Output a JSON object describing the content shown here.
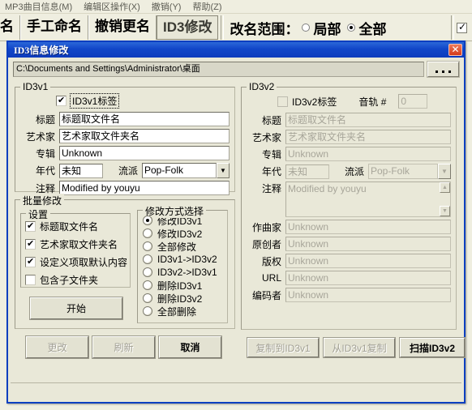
{
  "background": {
    "menubar": [
      {
        "label": "MP3曲目信息(M)"
      },
      {
        "label": "编辑区操作(X)"
      },
      {
        "label": "撤销(Y)"
      },
      {
        "label": "帮助(Z)"
      }
    ],
    "toolbar": {
      "partial_button": "名",
      "buttons": [
        {
          "label": "手工命名",
          "state": "normal"
        },
        {
          "label": "撤销更名",
          "state": "normal"
        },
        {
          "label": "ID3修改",
          "state": "pressed"
        }
      ],
      "scope_label": "改名范围：",
      "scope_options": [
        {
          "label": "局部",
          "selected": false
        },
        {
          "label": "全部",
          "selected": true
        }
      ],
      "right_checkbox_checked": true
    }
  },
  "dialog": {
    "title": "ID3信息修改",
    "close_label": "✕",
    "path": {
      "value": "C:\\Documents and Settings\\Administrator\\桌面",
      "browse_label": "..."
    },
    "id3v1": {
      "legend": "ID3v1",
      "tag_checkbox": {
        "label": "ID3v1标签",
        "checked": true
      },
      "fields": [
        {
          "label": "标题",
          "value": "标题取文件名"
        },
        {
          "label": "艺术家",
          "value": "艺术家取文件夹名"
        },
        {
          "label": "专辑",
          "value": "Unknown"
        }
      ],
      "year": {
        "label": "年代",
        "value": "未知"
      },
      "genre": {
        "label": "流派",
        "value": "Pop-Folk"
      },
      "comment": {
        "label": "注释",
        "value": "Modified by youyu"
      }
    },
    "id3v2": {
      "legend": "ID3v2",
      "tag_checkbox": {
        "label": "ID3v2标签",
        "checked": false
      },
      "track": {
        "label": "音轨 #",
        "value": "0"
      },
      "fields": [
        {
          "label": "标题",
          "value": "标题取文件名"
        },
        {
          "label": "艺术家",
          "value": "艺术家取文件夹名"
        },
        {
          "label": "专辑",
          "value": "Unknown"
        }
      ],
      "year": {
        "label": "年代",
        "value": "未知"
      },
      "genre": {
        "label": "流派",
        "value": "Pop-Folk"
      },
      "comment": {
        "label": "注释",
        "value": "Modified by youyu"
      },
      "extra_fields": [
        {
          "label": "作曲家",
          "value": "Unknown"
        },
        {
          "label": "原创者",
          "value": "Unknown"
        },
        {
          "label": "版权",
          "value": "Unknown"
        },
        {
          "label": "URL",
          "value": "Unknown"
        },
        {
          "label": "编码者",
          "value": "Unknown"
        }
      ],
      "buttons": [
        {
          "label": "复制到ID3v1",
          "enabled": false
        },
        {
          "label": "从ID3v1复制",
          "enabled": false
        },
        {
          "label": "扫描ID3v2",
          "enabled": true
        }
      ]
    },
    "batch": {
      "legend": "批量修改",
      "settings": {
        "legend": "设置",
        "items": [
          {
            "label": "标题取文件名",
            "checked": true
          },
          {
            "label": "艺术家取文件夹名",
            "checked": true
          },
          {
            "label": "设定义项取默认内容",
            "checked": true
          },
          {
            "label": "包含子文件夹",
            "checked": false
          }
        ]
      },
      "mode": {
        "legend": "修改方式选择",
        "options": [
          {
            "label": "修改ID3v1",
            "selected": true
          },
          {
            "label": "修改ID3v2",
            "selected": false
          },
          {
            "label": "全部修改",
            "selected": false
          },
          {
            "label": "ID3v1->ID3v2",
            "selected": false
          },
          {
            "label": "ID3v2->ID3v1",
            "selected": false
          },
          {
            "label": "删除ID3v1",
            "selected": false
          },
          {
            "label": "删除ID3v2",
            "selected": false
          },
          {
            "label": "全部删除",
            "selected": false
          }
        ]
      },
      "start_button": "开始"
    },
    "footer_buttons": [
      {
        "label": "更改",
        "enabled": false
      },
      {
        "label": "刷新",
        "enabled": false
      },
      {
        "label": "取消",
        "enabled": true
      }
    ]
  },
  "colors": {
    "title_blue": "#0d3bbd",
    "dialog_face": "#e9e8d8",
    "app_face": "#efeee0",
    "close_red": "#d43b1b"
  }
}
